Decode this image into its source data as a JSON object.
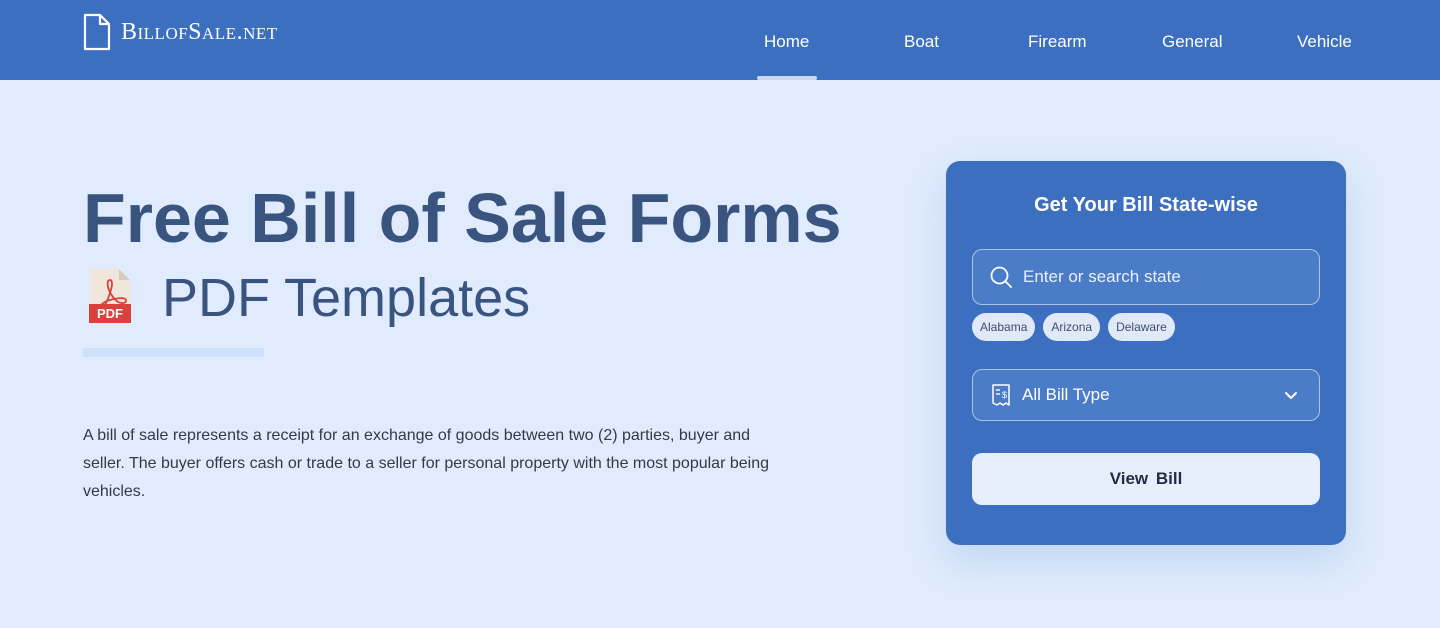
{
  "brand": {
    "name_part1": "Billof",
    "name_part2": "Sale.net",
    "logo_icon": "document-icon"
  },
  "nav": {
    "items": [
      {
        "label": "Home",
        "active": true
      },
      {
        "label": "Boat",
        "active": false
      },
      {
        "label": "Firearm",
        "active": false
      },
      {
        "label": "General",
        "active": false
      },
      {
        "label": "Vehicle",
        "active": false
      }
    ]
  },
  "hero": {
    "title": "Free Bill of Sale Forms",
    "subtitle": "PDF Templates",
    "pdf_badge": "PDF",
    "description": "A bill of sale represents a receipt for an exchange of goods between two (2) parties, buyer and seller. The buyer offers cash or trade to a seller for personal property with the most popular being vehicles."
  },
  "state_card": {
    "title": "Get Your Bill State-wise",
    "search_placeholder": "Enter or search state",
    "chips": [
      "Alabama",
      "Arizona",
      "Delaware"
    ],
    "bill_type_selected": "All Bill Type",
    "view_button": "View  Bill"
  },
  "colors": {
    "header_bg": "#3d6fc0",
    "page_bg": "#e0ecfd",
    "heading": "#3a5480",
    "pdf_red": "#d9413d"
  }
}
